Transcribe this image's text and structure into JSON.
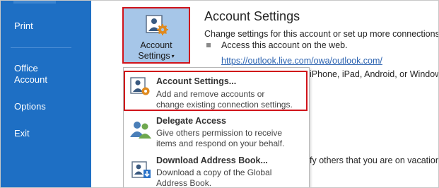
{
  "nav": {
    "items": [
      {
        "label": "Print"
      },
      {
        "label": "Office Account",
        "line1": "Office",
        "line2": "Account"
      },
      {
        "label": "Options"
      },
      {
        "label": "Exit"
      }
    ]
  },
  "account_button": {
    "line1": "Account",
    "line2": "Settings",
    "caret": "▾"
  },
  "info": {
    "title": "Account Settings",
    "description": "Change settings for this account or set up more connections.",
    "bullet_text": "Access this account on the web.",
    "link": "https://outlook.live.com/owa/outlook.com/",
    "devices_trail": "iPhone, iPad, Android, or Windows",
    "vacation_trail": "fy others that you are on vacation,"
  },
  "menu": {
    "items": [
      {
        "title": "Account Settings...",
        "desc1": "Add and remove accounts or",
        "desc2": "change existing connection settings."
      },
      {
        "title": "Delegate Access",
        "desc1": "Give others permission to receive",
        "desc2": "items and respond on your behalf."
      },
      {
        "title": "Download Address Book...",
        "desc1": "Download a copy of the Global",
        "desc2": "Address Book."
      }
    ]
  },
  "colors": {
    "nav_bg": "#1e6fc4",
    "highlight_border": "#d0131a",
    "button_bg": "#a6c6e8",
    "link": "#2b62b0"
  }
}
